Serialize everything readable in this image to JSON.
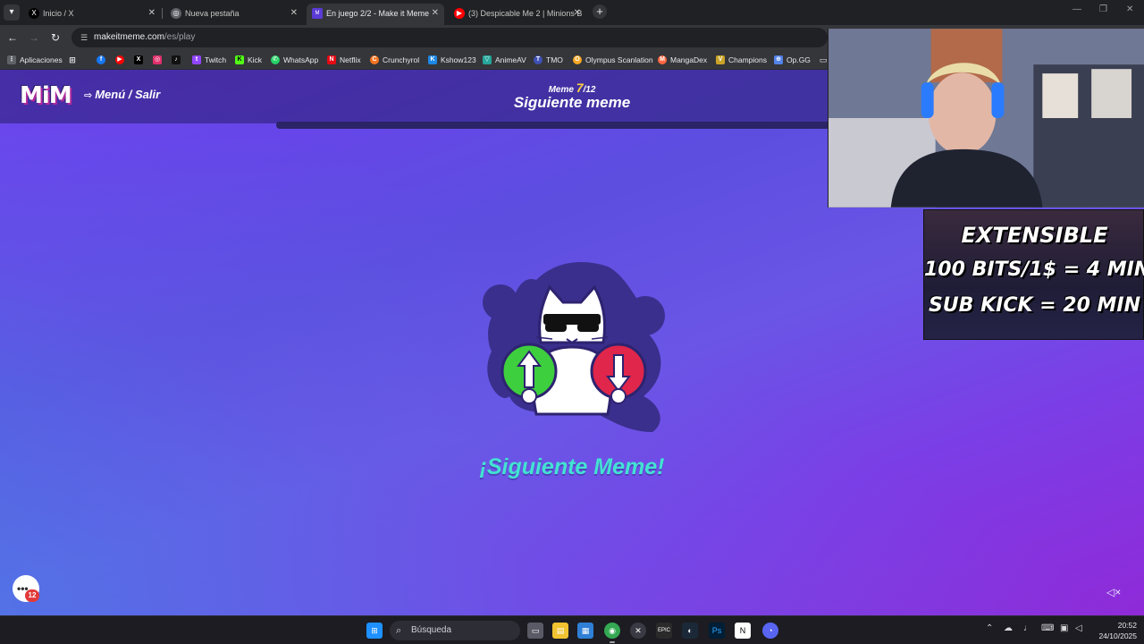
{
  "browser": {
    "tabs": [
      {
        "title": "Inicio / X",
        "icon": "x-logo-icon"
      },
      {
        "title": "Nueva pestaña",
        "icon": "chrome-icon"
      },
      {
        "title": "En juego 2/2 - Make it Meme",
        "icon": "mim-icon",
        "active": true
      },
      {
        "title": "(3) Despicable Me 2 | Minions B",
        "icon": "youtube-icon"
      }
    ],
    "url": {
      "host": "makeitmeme.com",
      "path": "/es/play"
    },
    "bookmarks": [
      {
        "label": "Aplicaciones",
        "icon": "apps-grid-icon"
      },
      {
        "label": "",
        "icon": "facebook-icon",
        "color": "#1877f2"
      },
      {
        "label": "",
        "icon": "youtube-icon",
        "color": "#ff0000"
      },
      {
        "label": "",
        "icon": "x-logo-icon",
        "color": "#000000"
      },
      {
        "label": "",
        "icon": "instagram-icon",
        "color": "#e1306c"
      },
      {
        "label": "",
        "icon": "tiktok-icon",
        "color": "#111111"
      },
      {
        "label": "Twitch",
        "icon": "twitch-icon",
        "color": "#9146ff"
      },
      {
        "label": "Kick",
        "icon": "kick-icon",
        "color": "#53fc18"
      },
      {
        "label": "WhatsApp",
        "icon": "whatsapp-icon",
        "color": "#25d366"
      },
      {
        "label": "Netflix",
        "icon": "netflix-icon",
        "color": "#e50914"
      },
      {
        "label": "Crunchyrol",
        "icon": "crunchyroll-icon",
        "color": "#f47521"
      },
      {
        "label": "Kshow123",
        "icon": "kshow-icon",
        "color": "#1e88e5"
      },
      {
        "label": "AnimeAV",
        "icon": "animeav-icon",
        "color": "#26a69a"
      },
      {
        "label": "TMO",
        "icon": "tmo-icon",
        "color": "#3f51b5"
      },
      {
        "label": "Olympus Scanlation",
        "icon": "olympus-icon",
        "color": "#f9a825"
      },
      {
        "label": "MangaDex",
        "icon": "mangadex-icon",
        "color": "#ff6740"
      },
      {
        "label": "Champions",
        "icon": "champions-icon",
        "color": "#c9a227"
      },
      {
        "label": "Op.GG",
        "icon": "opgg-icon",
        "color": "#5383e8"
      }
    ]
  },
  "game": {
    "logo": "MiM",
    "menu_label": "Menú / Salir",
    "counter_prefix": "Meme",
    "counter_current": "7",
    "counter_total": "/12",
    "stage_title": "Siguiente meme",
    "next_label": "¡Siguiente Meme!",
    "chat_badge": "12"
  },
  "stream_overlay": {
    "line1": "EXTENSIBLE",
    "line2": "100 BITS/1$ = 4 MIN",
    "line3": "SUB KICK = 20 MIN"
  },
  "taskbar": {
    "search_placeholder": "Búsqueda",
    "time": "20:52",
    "date": "24/10/2025"
  },
  "colors": {
    "accent_teal": "#43e2d2",
    "upvote_green": "#3ecf3e",
    "downvote_red": "#e0264a",
    "counter_yellow": "#ffd23f"
  }
}
